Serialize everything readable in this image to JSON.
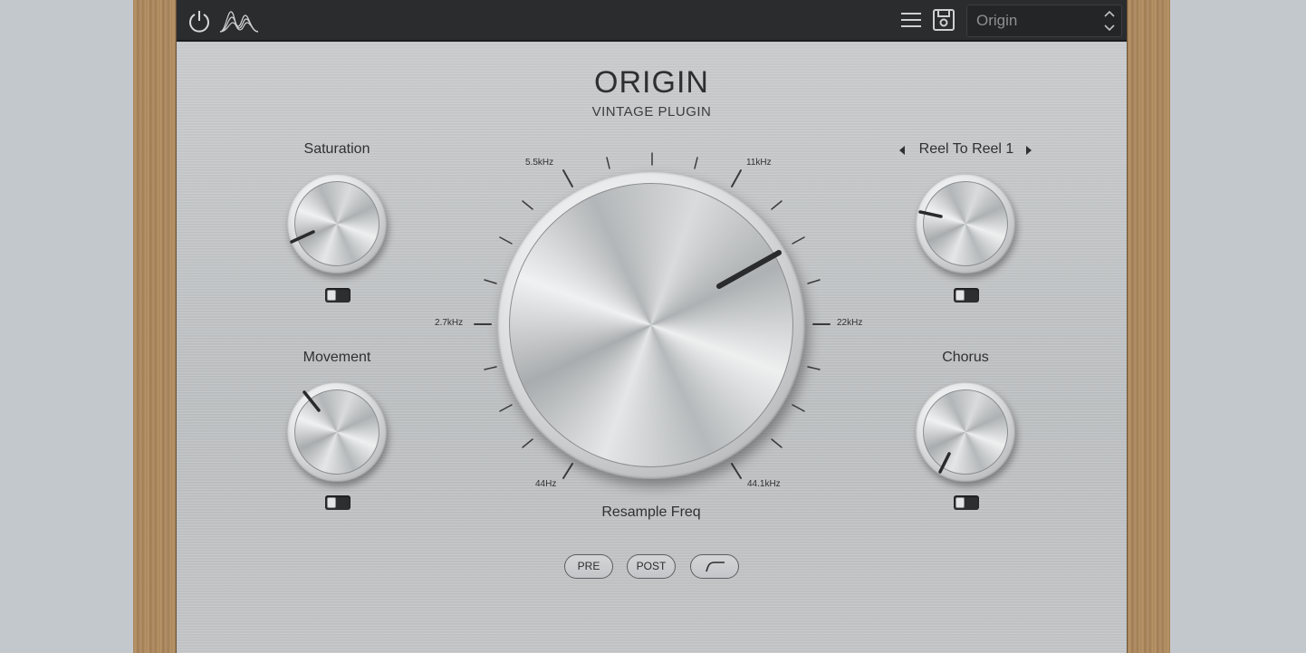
{
  "topbar": {
    "icons": [
      "power-icon",
      "waveform-logo-icon",
      "menu-icon",
      "save-icon",
      "chevron-updown-icon"
    ],
    "preset_name": "Origin"
  },
  "header": {
    "title": "ORIGIN",
    "subtitle": "VINTAGE PLUGIN"
  },
  "knobs": {
    "saturation": {
      "label": "Saturation"
    },
    "movement": {
      "label": "Movement"
    },
    "chorus": {
      "label": "Chorus"
    },
    "reel": {
      "label": "Reel To Reel 1"
    },
    "resample": {
      "label": "Resample Freq"
    }
  },
  "dial_labels": {
    "l44": "44Hz",
    "l27": "2.7kHz",
    "l55": "5.5kHz",
    "l11": "11kHz",
    "l22": "22kHz",
    "l441": "44.1kHz"
  },
  "buttons": {
    "pre": "PRE",
    "post": "POST"
  },
  "colors": {
    "topbar": "#2b2c2e",
    "panel": "#c2c4c6",
    "wood": "#a8865a"
  }
}
